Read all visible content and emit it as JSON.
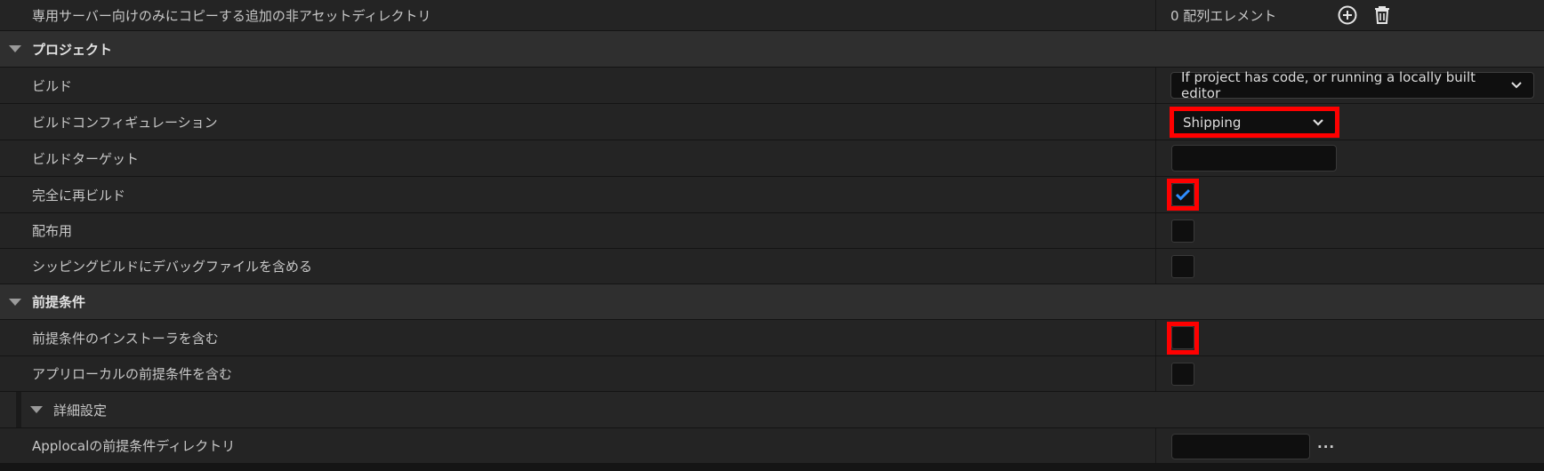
{
  "rows": {
    "extra_dirs": {
      "label": "専用サーバー向けのみにコピーする追加の非アセットディレクトリ",
      "value": "0 配列エレメント"
    },
    "project_header": {
      "label": "プロジェクト"
    },
    "build": {
      "label": "ビルド",
      "value": "If project has code, or running a locally built editor"
    },
    "build_config": {
      "label": "ビルドコンフィギュレーション",
      "value": "Shipping"
    },
    "build_target": {
      "label": "ビルドターゲット",
      "value": ""
    },
    "full_rebuild": {
      "label": "完全に再ビルド",
      "checked": true
    },
    "for_distribution": {
      "label": "配布用",
      "checked": false
    },
    "include_debug": {
      "label": "シッピングビルドにデバッグファイルを含める",
      "checked": false
    },
    "prereq_header": {
      "label": "前提条件"
    },
    "include_installer": {
      "label": "前提条件のインストーラを含む",
      "checked": false
    },
    "include_applocal": {
      "label": "アプリローカルの前提条件を含む",
      "checked": false
    },
    "advanced_header": {
      "label": "詳細設定"
    },
    "applocal_dir": {
      "label": "Applocalの前提条件ディレクトリ",
      "value": "",
      "browse": "..."
    }
  },
  "colors": {
    "highlight": "#ff0000",
    "check": "#2f8dff",
    "background": "#242424",
    "category": "#2f2f2f"
  },
  "icons": [
    "add-icon",
    "delete-icon",
    "chevron-down-icon",
    "checkmark-icon",
    "expand-triangle-icon"
  ]
}
